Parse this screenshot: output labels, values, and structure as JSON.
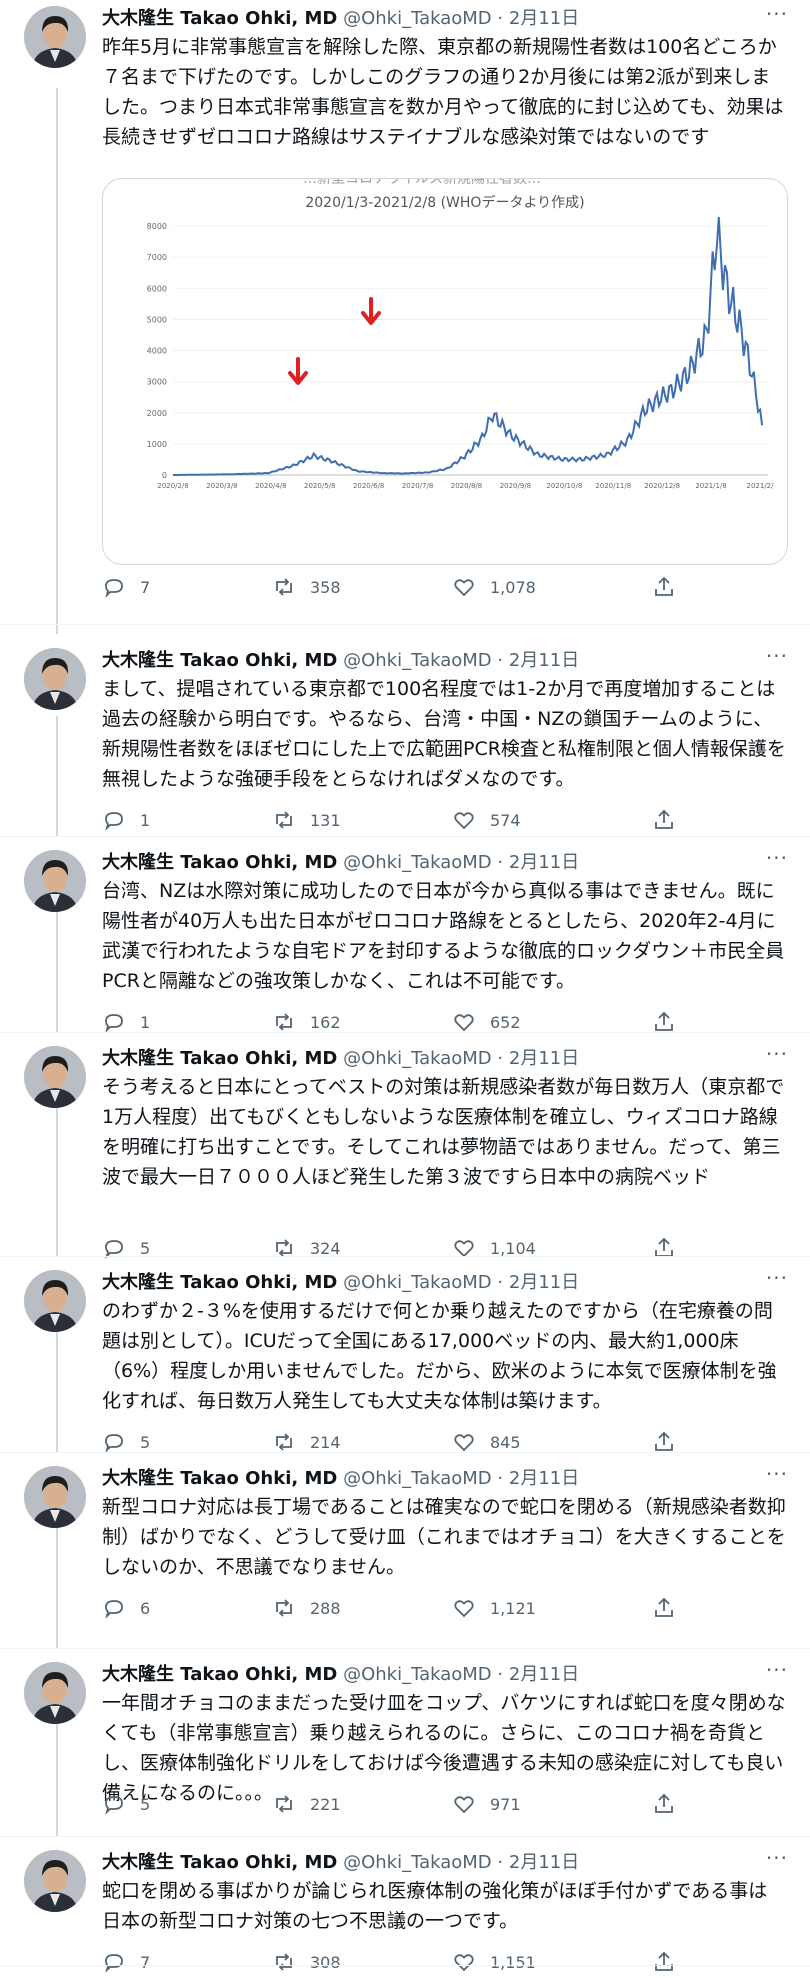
{
  "author": {
    "name": "大木隆生 Takao Ohki, MD",
    "handle": "@Ohki_TakaoMD",
    "separator": "·",
    "date": "2月11日",
    "more": "···"
  },
  "chart": {
    "title_partial": "…新型コロナウイルス新規陽性者数…",
    "subtitle": "2020/1/3-2021/2/8 (WHOデータより作成)"
  },
  "chart_data": {
    "type": "line",
    "title": "",
    "subtitle": "2020/1/3-2021/2/8 (WHOデータより作成)",
    "xlabel": "",
    "ylabel": "",
    "ylim": [
      0,
      8000
    ],
    "yticks": [
      0,
      1000,
      2000,
      3000,
      4000,
      5000,
      6000,
      7000,
      8000
    ],
    "xticks": [
      "2020/2/8",
      "2020/3/8",
      "2020/4/8",
      "2020/5/8",
      "2020/6/8",
      "2020/7/8",
      "2020/8/8",
      "2020/9/8",
      "2020/10/8",
      "2020/11/8",
      "2020/12/8",
      "2021/1/8",
      "2021/2/"
    ],
    "series": [
      {
        "color": "#3f6fb0",
        "x": [
          "2020/1/3",
          "2020/2/8",
          "2020/3/8",
          "2020/3/25",
          "2020/4/8",
          "2020/4/20",
          "2020/5/8",
          "2020/5/25",
          "2020/6/8",
          "2020/6/25",
          "2020/7/8",
          "2020/7/20",
          "2020/8/1",
          "2020/8/8",
          "2020/8/20",
          "2020/9/8",
          "2020/9/25",
          "2020/10/8",
          "2020/10/25",
          "2020/11/8",
          "2020/11/20",
          "2020/12/1",
          "2020/12/8",
          "2020/12/20",
          "2021/1/1",
          "2021/1/8",
          "2021/1/15",
          "2021/1/25",
          "2021/2/1",
          "2021/2/8"
        ],
        "values": [
          0,
          20,
          60,
          300,
          620,
          450,
          120,
          60,
          50,
          80,
          200,
          600,
          1200,
          1950,
          1300,
          650,
          500,
          500,
          650,
          1100,
          2100,
          2500,
          2700,
          3300,
          4500,
          7800,
          6000,
          4600,
          3300,
          1600
        ]
      }
    ],
    "annotations": [
      "red-arrow-down",
      "red-arrow-down"
    ]
  },
  "tweets": [
    {
      "text": "昨年5月に非常事態宣言を解除した際、東京都の新規陽性者数は100名どころか７名まで下げたのです。しかしこのグラフの通り2か月後には第2派が到来しました。つまり日本式非常事態宣言を数か月やって徹底的に封じ込めても、効果は長続きせずゼロコロナ路線はサステイナブルな感染対策ではないのです",
      "replies": "7",
      "retweets": "358",
      "likes": "1,078"
    },
    {
      "text": "まして、提唱されている東京都で100名程度では1-2か月で再度増加することは過去の経験から明白です。やるなら、台湾・中国・NZの鎖国チームのように、新規陽性者数をほぼゼロにした上で広範囲PCR検査と私権制限と個人情報保護を無視したような強硬手段をとらなければダメなのです。",
      "replies": "1",
      "retweets": "131",
      "likes": "574"
    },
    {
      "text": "台湾、NZは水際対策に成功したので日本が今から真似る事はできません。既に陽性者が40万人も出た日本がゼロコロナ路線をとるとしたら、2020年2-4月に武漢で行われたような自宅ドアを封印するような徹底的ロックダウン＋市民全員PCRと隔離などの強攻策しかなく、これは不可能です。",
      "replies": "1",
      "retweets": "162",
      "likes": "652"
    },
    {
      "text": "そう考えると日本にとってベストの対策は新規感染者数が毎日数万人（東京都で1万人程度）出てもびくともしないような医療体制を確立し、ウィズコロナ路線を明確に打ち出すことです。そしてこれは夢物語ではありません。だって、第三波で最大一日７０００人ほど発生した第３波ですら日本中の病院ベッド",
      "replies": "5",
      "retweets": "324",
      "likes": "1,104"
    },
    {
      "text": "のわずか２-３%を使用するだけで何とか乗り越えたのですから（在宅療養の問題は別として）。ICUだって全国にある17,000ベッドの内、最大約1,000床（6%）程度しか用いませんでした。だから、欧米のように本気で医療体制を強化すれば、毎日数万人発生しても大丈夫な体制は築けます。",
      "replies": "5",
      "retweets": "214",
      "likes": "845"
    },
    {
      "text": "新型コロナ対応は長丁場であることは確実なので蛇口を閉める（新規感染者数抑制）ばかりでなく、どうして受け皿（これまではオチョコ）を大きくすることをしないのか、不思議でなりません。",
      "replies": "6",
      "retweets": "288",
      "likes": "1,121"
    },
    {
      "text": "一年間オチョコのままだった受け皿をコップ、バケツにすれば蛇口を度々閉めなくても（非常事態宣言）乗り越えられるのに。さらに、このコロナ禍を奇貨とし、医療体制強化ドリルをしておけば今後遭遇する未知の感染症に対しても良い備えになるのに。。。",
      "replies": "5",
      "retweets": "221",
      "likes": "971"
    },
    {
      "text": "蛇口を閉める事ばかりが論じられ医療体制の強化策がほぼ手付かずである事は日本の新型コロナ対策の七つ不思議の一つです。",
      "replies": "7",
      "retweets": "308",
      "likes": "1,151"
    }
  ]
}
